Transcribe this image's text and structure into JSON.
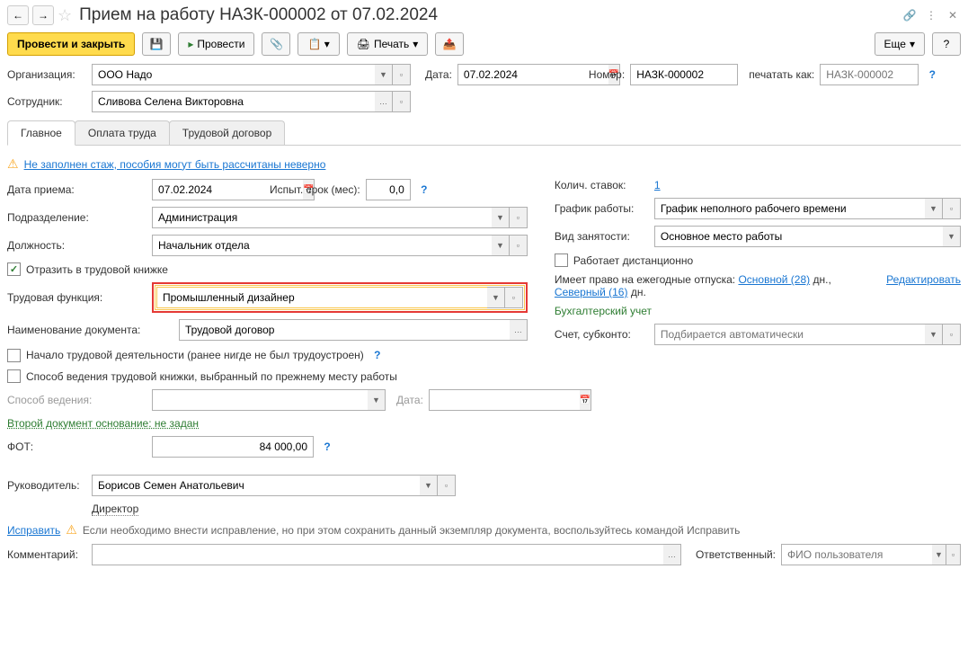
{
  "title": "Прием на работу НАЗК-000002 от 07.02.2024",
  "toolbar": {
    "post_close": "Провести и закрыть",
    "post": "Провести",
    "print": "Печать",
    "more": "Еще"
  },
  "header": {
    "org_label": "Организация:",
    "org_value": "ООО Надо",
    "date_label": "Дата:",
    "date_value": "07.02.2024",
    "number_label": "Номер:",
    "number_value": "НАЗК-000002",
    "print_as_label": "печатать как:",
    "print_as_placeholder": "НАЗК-000002",
    "employee_label": "Сотрудник:",
    "employee_value": "Сливова Селена Викторовна"
  },
  "tabs": {
    "main": "Главное",
    "pay": "Оплата труда",
    "contract": "Трудовой договор"
  },
  "warning_text": "Не заполнен стаж, пособия могут быть рассчитаны неверно",
  "left": {
    "hire_date_label": "Дата приема:",
    "hire_date_value": "07.02.2024",
    "trial_label": "Испыт. срок (мес):",
    "trial_value": "0,0",
    "dept_label": "Подразделение:",
    "dept_value": "Администрация",
    "position_label": "Должность:",
    "position_value": "Начальник отдела",
    "reflect_label": "Отразить в трудовой книжке",
    "function_label": "Трудовая функция:",
    "function_value": "Промышленный дизайнер",
    "doc_name_label": "Наименование документа:",
    "doc_name_value": "Трудовой договор",
    "first_job_label": "Начало трудовой деятельности (ранее нигде не был трудоустроен)",
    "method_prev_label": "Способ ведения трудовой книжки, выбранный по прежнему месту работы",
    "method_label": "Способ ведения:",
    "date2_label": "Дата:",
    "second_doc_link": "Второй документ основание: не задан",
    "fot_label": "ФОТ:",
    "fot_value": "84 000,00"
  },
  "right": {
    "rates_label": "Колич. ставок:",
    "rates_value": "1",
    "schedule_label": "График работы:",
    "schedule_value": "График неполного рабочего времени",
    "emp_type_label": "Вид занятости:",
    "emp_type_value": "Основное место работы",
    "remote_label": "Работает дистанционно",
    "vacation_prefix": "Имеет право на ежегодные отпуска:",
    "vacation_main": "Основной (28)",
    "vacation_days": "дн.,",
    "vacation_north": "Северный (16)",
    "vacation_days2": "дн.",
    "edit_link": "Редактировать",
    "accounting_label": "Бухгалтерский учет",
    "account_label": "Счет, субконто:",
    "account_placeholder": "Подбирается автоматически"
  },
  "footer": {
    "manager_label": "Руководитель:",
    "manager_value": "Борисов Семен Анатольевич",
    "director": "Директор",
    "fix_link": "Исправить",
    "fix_text": "Если необходимо внести исправление, но при этом сохранить данный экземпляр документа, воспользуйтесь командой Исправить",
    "comment_label": "Комментарий:",
    "responsible_label": "Ответственный:",
    "responsible_placeholder": "ФИО пользователя"
  }
}
